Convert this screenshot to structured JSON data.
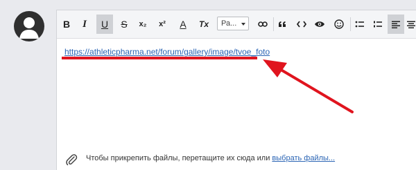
{
  "toolbar": {
    "bold": "B",
    "italic": "I",
    "underline": "U",
    "strike": "S",
    "subscript": "x₂",
    "superscript": "x²",
    "font_color": "A",
    "clear_format": "Tx",
    "font_size_value": "Ра..."
  },
  "editor": {
    "link_text": "https://athleticpharma.net/forum/gallery/image/tvoe_foto"
  },
  "footer": {
    "hint_text": "Чтобы прикрепить файлы, перетащите их сюда или ",
    "choose_files": "выбрать файлы..."
  },
  "colors": {
    "annotation": "#e0141e",
    "link": "#2a64b4"
  }
}
